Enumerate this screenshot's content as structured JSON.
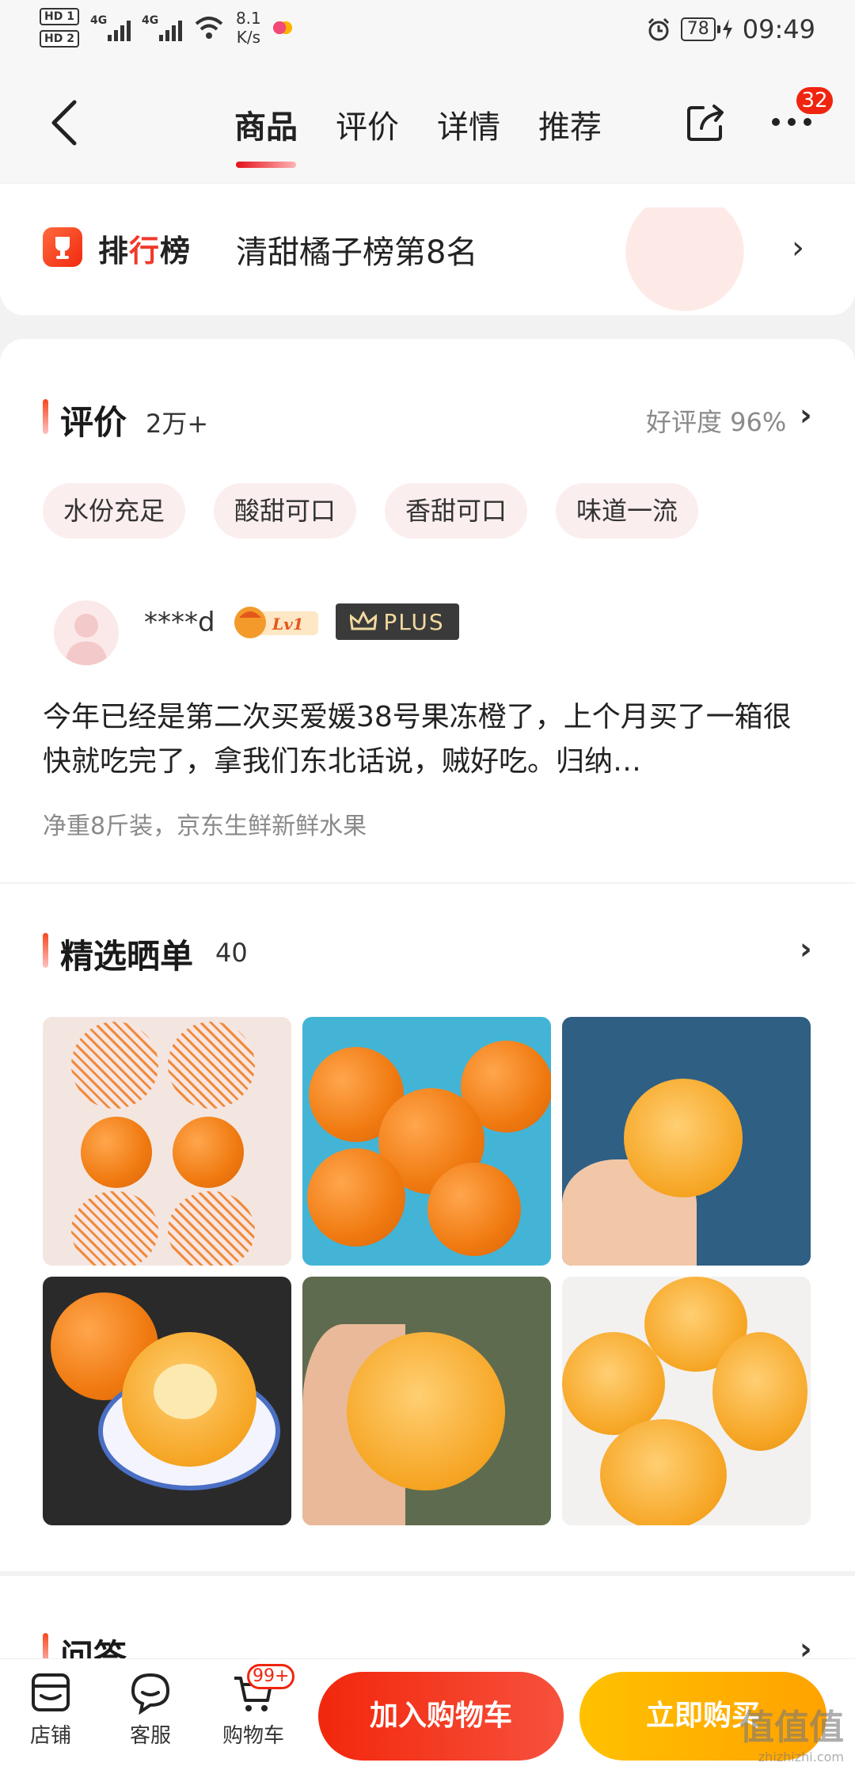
{
  "status_bar": {
    "hd1": "HD 1",
    "hd2": "HD 2",
    "signal1_label": "4G",
    "signal2_label": "4G",
    "speed_value": "8.1",
    "speed_unit": "K/s",
    "battery": "78",
    "time": "09:49"
  },
  "nav": {
    "tabs": [
      "商品",
      "评价",
      "详情",
      "推荐"
    ],
    "active_tab": "商品",
    "more_badge": "32"
  },
  "ranking": {
    "logo_prefix": "排",
    "logo_accent": "行",
    "logo_suffix": "榜",
    "text": "清甜橘子榜第8名",
    "arrow": "›"
  },
  "reviews": {
    "title": "评价",
    "count": "2万+",
    "rating_label": "好评度 96%",
    "arrow": "›",
    "tags": [
      "水份充足",
      "酸甜可口",
      "香甜可口",
      "味道一流"
    ],
    "item": {
      "username": "****d",
      "level_badge": "Lv1",
      "plus_badge": "PLUS",
      "text": "今年已经是第二次买爱媛38号果冻橙了，上个月买了一箱很快就吃完了，拿我们东北话说，贼好吃。归纳…",
      "meta": "净重8斤装，京东生鲜新鲜水果"
    }
  },
  "showcase": {
    "title": "精选晒单",
    "count": "40",
    "arrow": "›"
  },
  "qa": {
    "title": "问答",
    "arrow": "›"
  },
  "bottom_bar": {
    "store": "店铺",
    "service": "客服",
    "cart": "购物车",
    "cart_badge": "99+",
    "add_to_cart": "加入购物车",
    "buy_now": "立即购买"
  },
  "watermark": {
    "brand": "值值值",
    "url": "zhizhizhi.com"
  },
  "colors": {
    "accent_red": "#f2270c",
    "accent_yellow": "#ffb000",
    "tag_bg": "#fbeeee"
  }
}
